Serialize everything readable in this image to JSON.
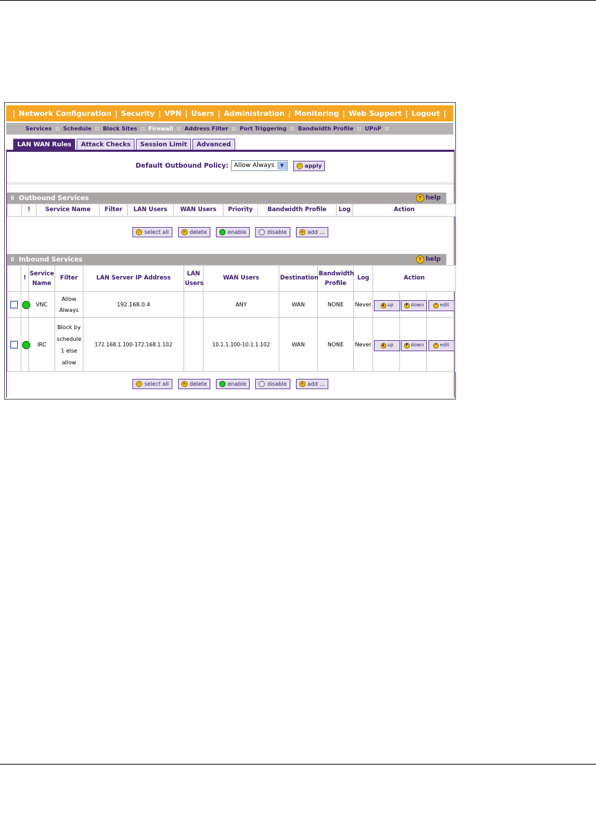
{
  "main_menu": [
    "Network Configuration",
    "Security",
    "VPN",
    "Users",
    "Administration",
    "Monitoring",
    "Web Support",
    "Logout"
  ],
  "sub_menu": [
    "Services",
    "Schedule",
    "Block Sites",
    "Firewall",
    "Address Filter",
    "Port Triggering",
    "Bandwidth Profile",
    "UPnP"
  ],
  "tabs": [
    "LAN WAN Rules",
    "Attack Checks",
    "Session Limit",
    "Advanced"
  ],
  "policy": {
    "label": "Default Outbound Policy:",
    "value": "Allow Always",
    "apply": "apply"
  },
  "help": "help",
  "outbound": {
    "title": "Outbound Services",
    "headers": [
      "!",
      "Service Name",
      "Filter",
      "LAN Users",
      "WAN Users",
      "Priority",
      "Bandwidth Profile",
      "Log",
      "Action"
    ]
  },
  "inbound": {
    "title": "Inbound Services",
    "headers": [
      "!",
      "Service Name",
      "Filter",
      "LAN Server IP Address",
      "LAN Users",
      "WAN Users",
      "Destination",
      "Bandwidth Profile",
      "Log",
      "Action"
    ],
    "rows": [
      {
        "service": "VNC",
        "filter": "Allow Always",
        "lan_ip": "192.168.0.4",
        "lan_users": "",
        "wan_users": "ANY",
        "destination": "WAN",
        "bandwidth": "NONE",
        "log": "Never"
      },
      {
        "service": "IRC",
        "filter": "Block by schedule 1 else allow",
        "lan_ip": "172.168.1.100-172.168.1.102",
        "lan_users": "",
        "wan_users": "10.1.1.100-10.1.1.102",
        "destination": "WAN",
        "bandwidth": "NONE",
        "log": "Never"
      }
    ],
    "row_actions": [
      "up",
      "down",
      "edit"
    ]
  },
  "buttons": [
    "select all",
    "delete",
    "enable",
    "disable",
    "add ..."
  ],
  "colors": {
    "menu": "#f5a623",
    "submenu": "#b7b3b3",
    "accent": "#4a2673",
    "enabled": "#1ec51e"
  }
}
